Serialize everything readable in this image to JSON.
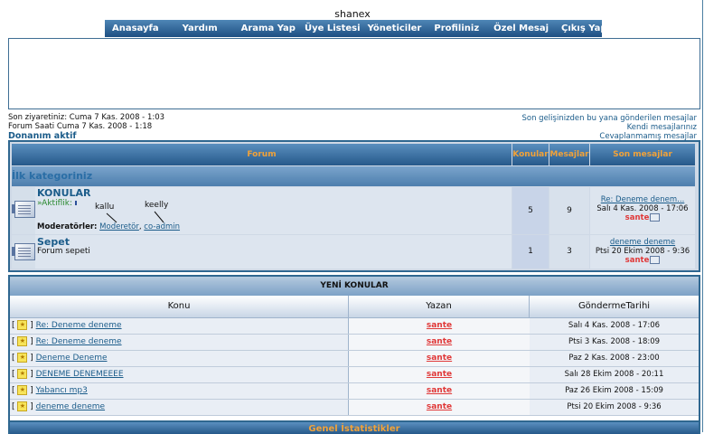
{
  "site": {
    "title": "shanex"
  },
  "nav": [
    "Anasayfa",
    "Yardım",
    "Arama Yap",
    "Üye Listesi",
    "Yöneticiler",
    "Profiliniz",
    "Özel Mesaj",
    "Çıkış Yap"
  ],
  "info": {
    "last_visit": "Son ziyaretiniz: Cuma 7 Kas. 2008 - 1:03",
    "forum_time": "Forum Saati Cuma 7 Kas. 2008 - 1:18",
    "status": "Donanım aktif",
    "links": [
      "Son gelişinizden bu yana gönderilen mesajlar",
      "Kendi mesajlarınız",
      "Cevaplanmamış mesajlar"
    ]
  },
  "forum_table": {
    "headers": {
      "forum": "Forum",
      "topics": "Konular",
      "posts": "Mesajlar",
      "last_post": "Son mesajlar"
    },
    "category": "İlk kategoriniz",
    "forums": [
      {
        "name": "KONULAR",
        "activity": "»Aktiflik:",
        "moderators_label": "Moderatörler:",
        "moderators": [
          "Moderetör",
          "co-admin"
        ],
        "topics": "5",
        "posts": "9",
        "last_title": "Re: Deneme denem...",
        "last_date": "Salı 4 Kas. 2008 - 17:06",
        "last_author": "sante"
      },
      {
        "name": "Sepet",
        "description": "Forum sepeti",
        "topics": "1",
        "posts": "3",
        "last_title": "deneme deneme",
        "last_date": "Ptsi 20 Ekim 2008 - 9:36",
        "last_author": "sante"
      }
    ],
    "annotations": [
      "kallu",
      "keelly"
    ]
  },
  "new_topics": {
    "title": "YENİ KONULAR",
    "columns": [
      "Konu",
      "Yazan",
      "GöndermeTarihi"
    ],
    "rows": [
      {
        "topic": "Re: Deneme deneme",
        "author": "sante",
        "date": "Salı 4 Kas. 2008 - 17:06"
      },
      {
        "topic": "Re: Deneme deneme",
        "author": "sante",
        "date": "Ptsi 3 Kas. 2008 - 18:09"
      },
      {
        "topic": "Deneme Deneme",
        "author": "sante",
        "date": "Paz 2 Kas. 2008 - 23:00"
      },
      {
        "topic": "DENEME DENEMEEEE",
        "author": "sante",
        "date": "Salı 28 Ekim 2008 - 20:11"
      },
      {
        "topic": "Yabancı mp3",
        "author": "sante",
        "date": "Paz 26 Ekim 2008 - 15:09"
      },
      {
        "topic": "deneme deneme",
        "author": "sante",
        "date": "Ptsi 20 Ekim 2008 - 9:36"
      }
    ]
  },
  "stats": {
    "title": "Genel İstatistikler"
  },
  "colors": {
    "header_orange": "#f0a23a",
    "link_blue": "#1b5c8a",
    "author_red": "#e03838",
    "border_blue": "#2f6790"
  }
}
